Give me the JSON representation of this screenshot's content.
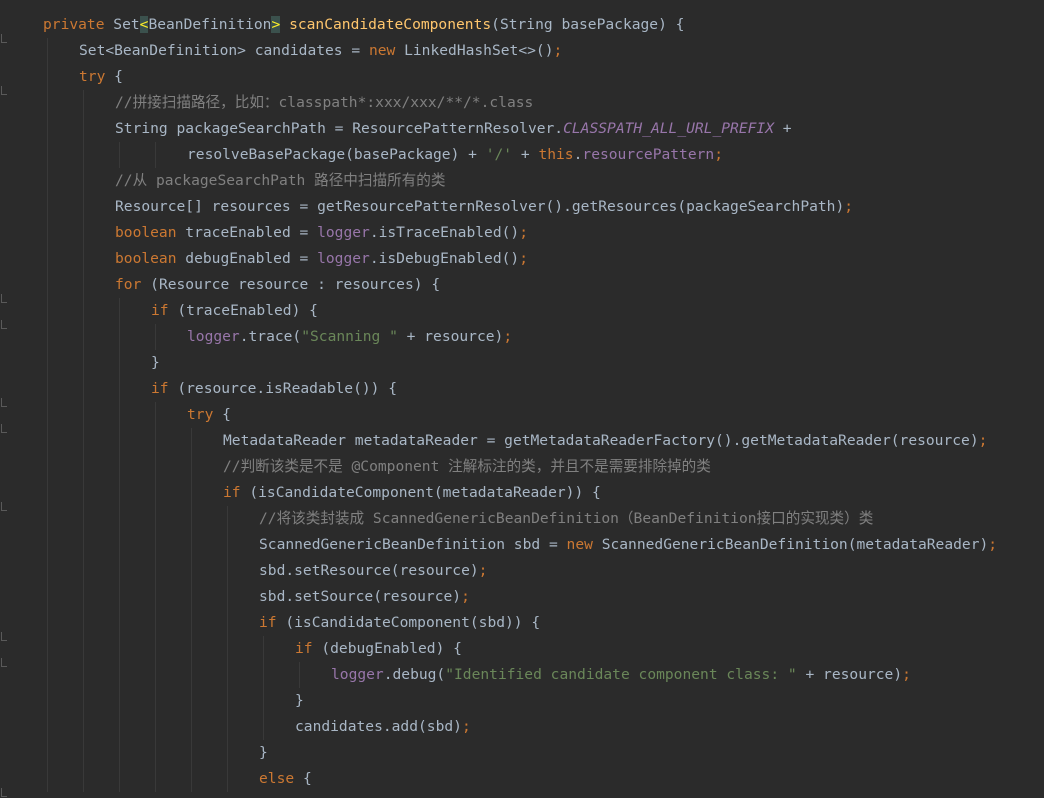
{
  "theme": {
    "background": "#2b2b2b",
    "default_text": "#a9b7c6",
    "keyword": "#cc7832",
    "comment": "#808080",
    "string": "#6a8759",
    "field": "#9876aa",
    "method_declaration": "#ffc66d",
    "bracket_match_highlight": "#3b514d"
  },
  "code_lines": [
    {
      "indent": 1,
      "tokens": [
        {
          "t": "private ",
          "c": "kw"
        },
        {
          "t": "Set"
        },
        {
          "t": "<",
          "c": "hl"
        },
        {
          "t": "BeanDefinition"
        },
        {
          "t": ">",
          "c": "hl"
        },
        {
          "t": " "
        },
        {
          "t": "scanCandidateComponents",
          "c": "mn"
        },
        {
          "t": "(String basePackage) {"
        }
      ]
    },
    {
      "indent": 2,
      "tokens": [
        {
          "t": "Set<BeanDefinition> candidates = "
        },
        {
          "t": "new ",
          "c": "kw"
        },
        {
          "t": "LinkedHashSet<>()"
        },
        {
          "t": ";",
          "c": "kw"
        }
      ]
    },
    {
      "indent": 2,
      "tokens": [
        {
          "t": "try ",
          "c": "kw"
        },
        {
          "t": "{"
        }
      ]
    },
    {
      "indent": 3,
      "tokens": [
        {
          "t": "//拼接扫描路径，比如：classpath*:xxx/xxx/**/*.class",
          "c": "cm"
        }
      ]
    },
    {
      "indent": 3,
      "tokens": [
        {
          "t": "String packageSearchPath = ResourcePatternResolver."
        },
        {
          "t": "CLASSPATH_ALL_URL_PREFIX",
          "c": "fdi"
        },
        {
          "t": " +"
        }
      ]
    },
    {
      "indent": 5,
      "tokens": [
        {
          "t": "resolveBasePackage(basePackage) + "
        },
        {
          "t": "'/'",
          "c": "st"
        },
        {
          "t": " + "
        },
        {
          "t": "this",
          "c": "kw"
        },
        {
          "t": "."
        },
        {
          "t": "resourcePattern",
          "c": "fd"
        },
        {
          "t": ";",
          "c": "kw"
        }
      ]
    },
    {
      "indent": 3,
      "tokens": [
        {
          "t": "//从 packageSearchPath 路径中扫描所有的类",
          "c": "cm"
        }
      ]
    },
    {
      "indent": 3,
      "tokens": [
        {
          "t": "Resource[] resources = getResourcePatternResolver().getResources(packageSearchPath)"
        },
        {
          "t": ";",
          "c": "kw"
        }
      ]
    },
    {
      "indent": 3,
      "tokens": [
        {
          "t": "boolean ",
          "c": "kw"
        },
        {
          "t": "traceEnabled = "
        },
        {
          "t": "logger",
          "c": "fd"
        },
        {
          "t": ".isTraceEnabled()"
        },
        {
          "t": ";",
          "c": "kw"
        }
      ]
    },
    {
      "indent": 3,
      "tokens": [
        {
          "t": "boolean ",
          "c": "kw"
        },
        {
          "t": "debugEnabled = "
        },
        {
          "t": "logger",
          "c": "fd"
        },
        {
          "t": ".isDebugEnabled()"
        },
        {
          "t": ";",
          "c": "kw"
        }
      ]
    },
    {
      "indent": 3,
      "tokens": [
        {
          "t": "for ",
          "c": "kw"
        },
        {
          "t": "(Resource resource : resources) {"
        }
      ]
    },
    {
      "indent": 4,
      "tokens": [
        {
          "t": "if ",
          "c": "kw"
        },
        {
          "t": "(traceEnabled) {"
        }
      ]
    },
    {
      "indent": 5,
      "tokens": [
        {
          "t": "logger",
          "c": "fd"
        },
        {
          "t": ".trace("
        },
        {
          "t": "\"Scanning \"",
          "c": "st"
        },
        {
          "t": " + resource)"
        },
        {
          "t": ";",
          "c": "kw"
        }
      ]
    },
    {
      "indent": 4,
      "tokens": [
        {
          "t": "}"
        }
      ]
    },
    {
      "indent": 4,
      "tokens": [
        {
          "t": "if ",
          "c": "kw"
        },
        {
          "t": "(resource.isReadable()) {"
        }
      ]
    },
    {
      "indent": 5,
      "tokens": [
        {
          "t": "try ",
          "c": "kw"
        },
        {
          "t": "{"
        }
      ]
    },
    {
      "indent": 6,
      "tokens": [
        {
          "t": "MetadataReader metadataReader = getMetadataReaderFactory().getMetadataReader(resource)"
        },
        {
          "t": ";",
          "c": "kw"
        }
      ]
    },
    {
      "indent": 6,
      "tokens": [
        {
          "t": "//判断该类是不是 @Component 注解标注的类，并且不是需要排除掉的类",
          "c": "cm"
        }
      ]
    },
    {
      "indent": 6,
      "tokens": [
        {
          "t": "if ",
          "c": "kw"
        },
        {
          "t": "(isCandidateComponent(metadataReader)) {"
        }
      ]
    },
    {
      "indent": 7,
      "tokens": [
        {
          "t": "//将该类封装成 ScannedGenericBeanDefinition（BeanDefinition接口的实现类）类",
          "c": "cm"
        }
      ]
    },
    {
      "indent": 7,
      "tokens": [
        {
          "t": "ScannedGenericBeanDefinition sbd = "
        },
        {
          "t": "new ",
          "c": "kw"
        },
        {
          "t": "ScannedGenericBeanDefinition(metadataReader)"
        },
        {
          "t": ";",
          "c": "kw"
        }
      ]
    },
    {
      "indent": 7,
      "tokens": [
        {
          "t": "sbd.setResource(resource)"
        },
        {
          "t": ";",
          "c": "kw"
        }
      ]
    },
    {
      "indent": 7,
      "tokens": [
        {
          "t": "sbd.setSource(resource)"
        },
        {
          "t": ";",
          "c": "kw"
        }
      ]
    },
    {
      "indent": 7,
      "tokens": [
        {
          "t": "if ",
          "c": "kw"
        },
        {
          "t": "(isCandidateComponent(sbd)) {"
        }
      ]
    },
    {
      "indent": 8,
      "tokens": [
        {
          "t": "if ",
          "c": "kw"
        },
        {
          "t": "(debugEnabled) {"
        }
      ]
    },
    {
      "indent": 9,
      "tokens": [
        {
          "t": "logger",
          "c": "fd"
        },
        {
          "t": ".debug("
        },
        {
          "t": "\"Identified candidate component class: \"",
          "c": "st"
        },
        {
          "t": " + resource)"
        },
        {
          "t": ";",
          "c": "kw"
        }
      ]
    },
    {
      "indent": 8,
      "tokens": [
        {
          "t": "}"
        }
      ]
    },
    {
      "indent": 8,
      "tokens": [
        {
          "t": "candidates.add(sbd)"
        },
        {
          "t": ";",
          "c": "kw"
        }
      ]
    },
    {
      "indent": 7,
      "tokens": [
        {
          "t": "}"
        }
      ]
    },
    {
      "indent": 7,
      "tokens": [
        {
          "t": "else ",
          "c": "kw"
        },
        {
          "t": "{"
        }
      ]
    }
  ]
}
